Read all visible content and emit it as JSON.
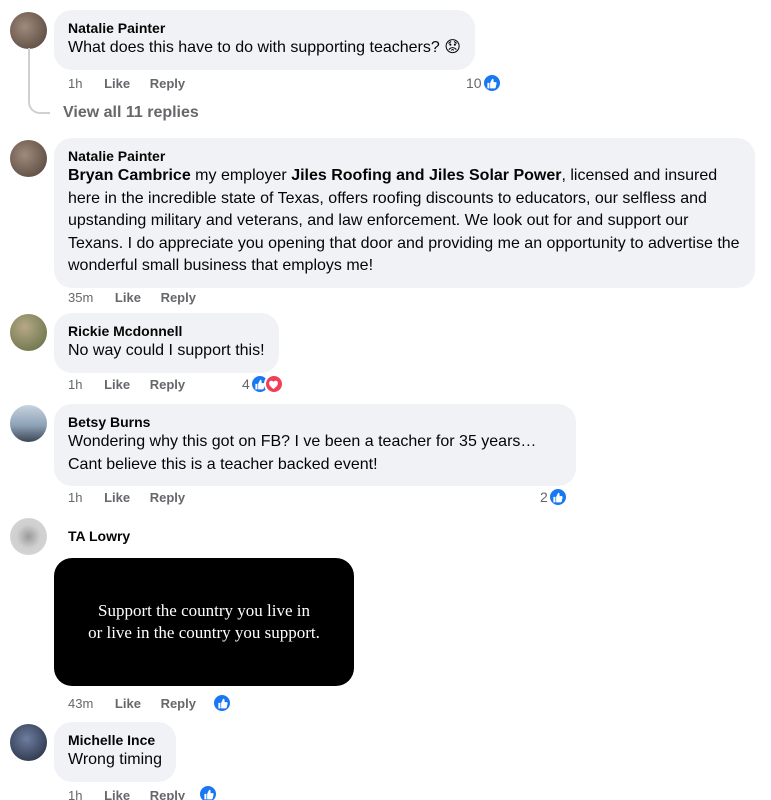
{
  "comments": [
    {
      "name": "Natalie Painter",
      "text": "What does this have to do with supporting teachers?",
      "emoji": "😟",
      "time": "1h",
      "like": "Like",
      "reply": "Reply",
      "reaction_count": "10",
      "view_replies": "View all 11 replies",
      "avatar_color": "#6b5a4e"
    },
    {
      "name": "Natalie Painter",
      "mention": "Bryan Cambrice",
      "text_a": " my employer ",
      "company": "Jiles Roofing and Jiles Solar Power",
      "text_b": ", licensed and insured here in the incredible state of Texas, offers roofing discounts to educators, our selfless and upstanding military and veterans, and law enforcement. We look out for and support our Texans. I do appreciate you opening that door and providing me an opportunity to advertise the wonderful small business that employs me!",
      "time": "35m",
      "like": "Like",
      "reply": "Reply",
      "avatar_color": "#6b5a4e"
    },
    {
      "name": "Rickie Mcdonnell",
      "text": "No way could I support this!",
      "time": "1h",
      "like": "Like",
      "reply": "Reply",
      "reaction_count": "4",
      "avatar_color": "#7a8a5c"
    },
    {
      "name": "Betsy Burns",
      "text": "Wondering why this got on FB? I ve been a teacher for 35 years… Cant believe this is a teacher backed event!",
      "time": "1h",
      "like": "Like",
      "reply": "Reply",
      "reaction_count": "2",
      "avatar_color": "#8fa3b8"
    },
    {
      "name": "TA Lowry",
      "image_text_line1": "Support the country you live in",
      "image_text_line2": "or live in the country you support.",
      "time": "43m",
      "like": "Like",
      "reply": "Reply",
      "avatar_color": "#c9c9c9"
    },
    {
      "name": "Michelle Ince",
      "text": "Wrong timing",
      "time": "1h",
      "like": "Like",
      "reply": "Reply",
      "avatar_color": "#2f3a4e"
    }
  ],
  "colors": {
    "bubble": "#f0f2f5",
    "like_blue": "#1877f2",
    "love_red": "#f33e58",
    "meta_gray": "#65676b"
  }
}
